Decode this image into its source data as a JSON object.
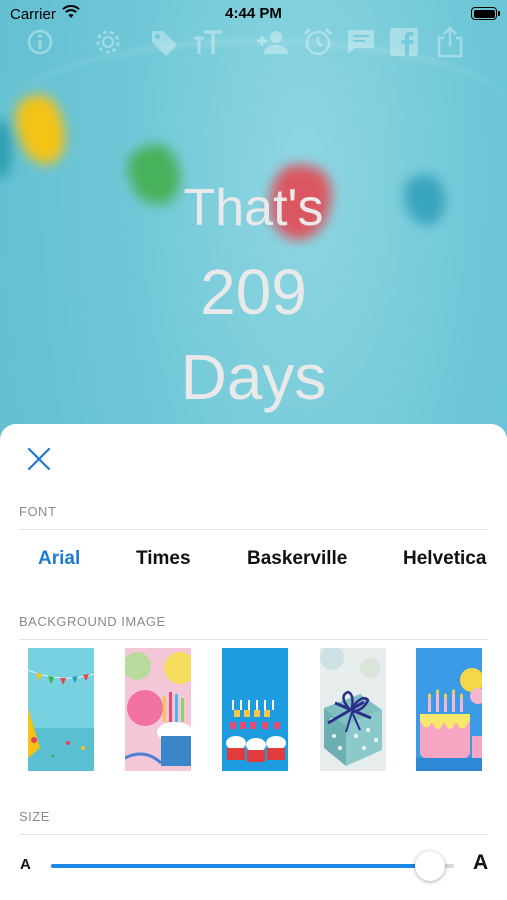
{
  "status_bar": {
    "carrier": "Carrier",
    "time": "4:44 PM"
  },
  "toolbar": {
    "icons": [
      "info-icon",
      "gear-icon",
      "tag-icon",
      "text-size-icon",
      "add-person-icon",
      "alarm-icon",
      "message-icon",
      "facebook-icon",
      "share-icon"
    ]
  },
  "counter": {
    "line1": "That's",
    "line2": "209",
    "line3": "Days"
  },
  "sheet": {
    "font_section": {
      "title": "FONT",
      "options": [
        "Arial",
        "Times",
        "Baskerville",
        "Helvetica"
      ],
      "selected": "Arial"
    },
    "background_section": {
      "title": "BACKGROUND IMAGE",
      "thumbnails": [
        "bunting-party",
        "balloons-candles-cupcake",
        "happy-birthday-cupcakes",
        "gift-box",
        "birthday-cake-balloons"
      ]
    },
    "size_section": {
      "title": "SIZE",
      "min_label": "A",
      "max_label": "A",
      "value": 0.94
    }
  },
  "colors": {
    "accent": "#1f7ad6",
    "slider": "#1e88e5",
    "background": "#6cc8d6"
  }
}
